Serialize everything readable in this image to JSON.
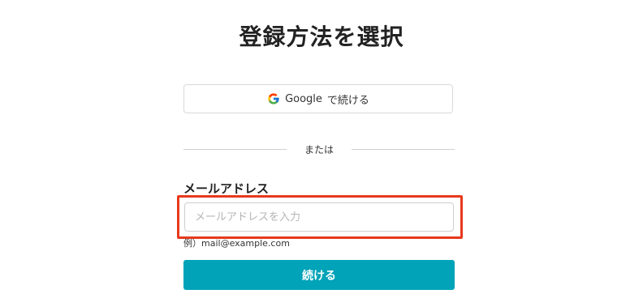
{
  "page": {
    "title": "登録方法を選択"
  },
  "google_button": {
    "brand": "Google",
    "suffix": "で続ける",
    "icon": "google-logo-icon"
  },
  "divider": {
    "text": "または"
  },
  "email": {
    "label": "メールアドレス",
    "placeholder": "メールアドレスを入力",
    "value": "",
    "hint": "例）mail@example.com"
  },
  "continue_button": {
    "label": "続ける"
  },
  "colors": {
    "accent": "#00a3b8",
    "highlight": "#e8391d"
  }
}
